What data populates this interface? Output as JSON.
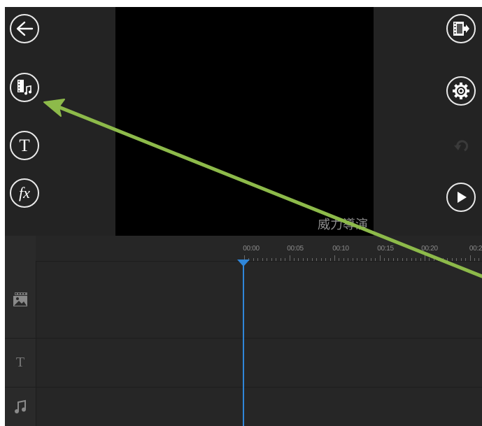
{
  "toolbar_left": {
    "back_icon": "arrow-left-icon",
    "media_icon": "film-music-icon",
    "title_button_label": "T",
    "effects_button_label": "fx"
  },
  "toolbar_right": {
    "produce_icon": "film-export-icon",
    "settings_icon": "gear-icon",
    "undo_icon": "undo-icon",
    "play_icon": "play-icon"
  },
  "preview": {
    "watermark": "威力導演"
  },
  "timeline": {
    "time_labels": [
      "00:00",
      "00:05",
      "00:10",
      "00:15",
      "00:20",
      "00:2"
    ],
    "tracks": [
      {
        "name": "video",
        "icon": "image-track-icon"
      },
      {
        "name": "title",
        "icon": "text-track-icon",
        "label": "T"
      },
      {
        "name": "audio",
        "icon": "music-note-icon"
      }
    ]
  },
  "colors": {
    "playhead": "#2f86d9",
    "annotation_arrow": "#8dba4a"
  }
}
